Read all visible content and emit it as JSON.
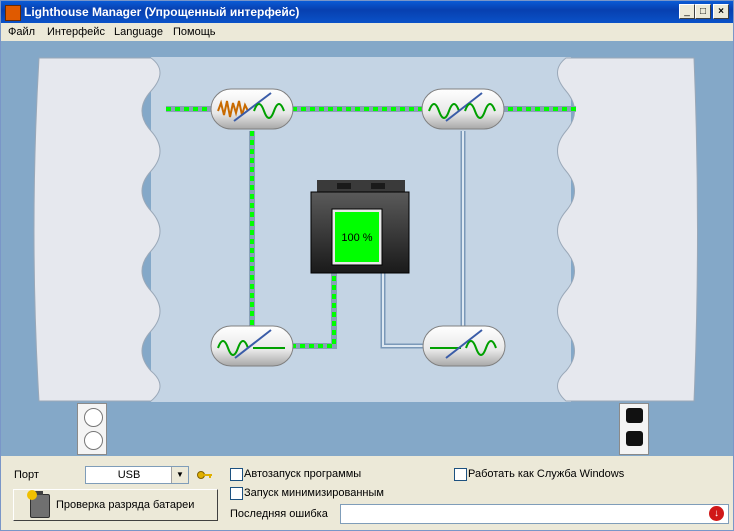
{
  "window": {
    "title": "Lighthouse Manager (Упрощенный интерфейс)",
    "minimize": "_",
    "maximize": "□",
    "close": "×"
  },
  "menu": {
    "items": [
      "Файл",
      "Интерфейс",
      "Language",
      "Помощь"
    ]
  },
  "diagram": {
    "battery_level": "100 %",
    "battery_fill": 1.0
  },
  "controls": {
    "port_label": "Порт",
    "port_value": "USB",
    "autostart_label": "Автозапуск программы",
    "minimized_label": "Запуск минимизированным",
    "service_label": "Работать как Служба Windows",
    "battery_test_label": "Проверка разряда батареи",
    "last_error_label": "Последняя ошибка",
    "last_error_value": ""
  },
  "colors": {
    "accent_green": "#00ff00",
    "panel_blue": "#84a8c8",
    "inner_panel": "#c4d4e4"
  }
}
